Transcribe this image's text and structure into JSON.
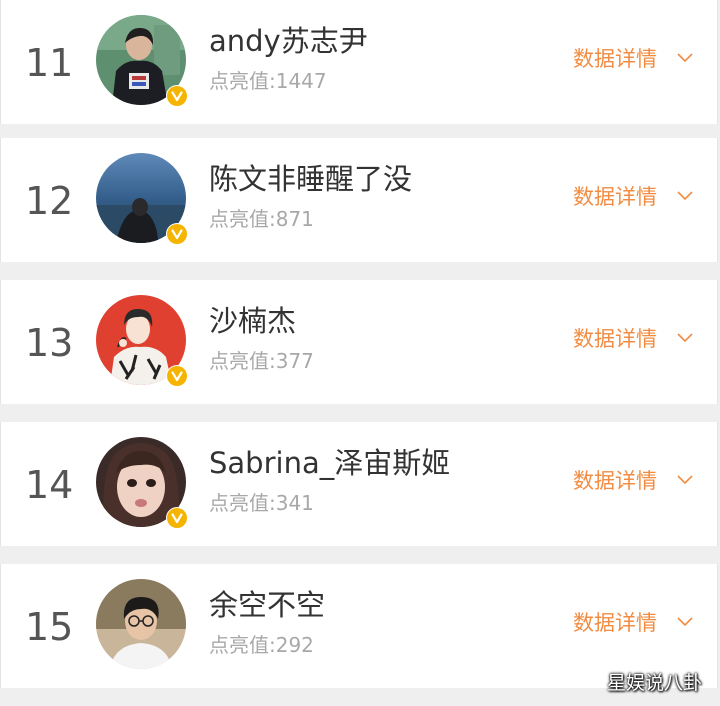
{
  "colors": {
    "accent": "#f28c42",
    "badge": "#f5b400",
    "rank_text": "#555555",
    "score_text": "#a8a8a8",
    "background": "#efefef"
  },
  "ranking": [
    {
      "rank": "11",
      "name": "andy苏志尹",
      "score": "点亮值:1447",
      "detail_label": "数据详情",
      "avatar": "avatar-photo-man-green",
      "badge": "verified-v-badge"
    },
    {
      "rank": "12",
      "name": "陈文非睡醒了没",
      "score": "点亮值:871",
      "detail_label": "数据详情",
      "avatar": "avatar-photo-sea",
      "badge": "verified-v-badge"
    },
    {
      "rank": "13",
      "name": "沙楠杰",
      "score": "点亮值:377",
      "detail_label": "数据详情",
      "avatar": "avatar-illustration-red",
      "badge": "verified-v-badge"
    },
    {
      "rank": "14",
      "name": "Sabrina_泽宙斯姬",
      "score": "点亮值:341",
      "detail_label": "数据详情",
      "avatar": "avatar-photo-woman",
      "badge": "verified-v-badge"
    },
    {
      "rank": "15",
      "name": "余空不空",
      "score": "点亮值:292",
      "detail_label": "数据详情",
      "avatar": "avatar-photo-man-glasses",
      "badge": ""
    }
  ],
  "watermark": "星娱说八卦"
}
